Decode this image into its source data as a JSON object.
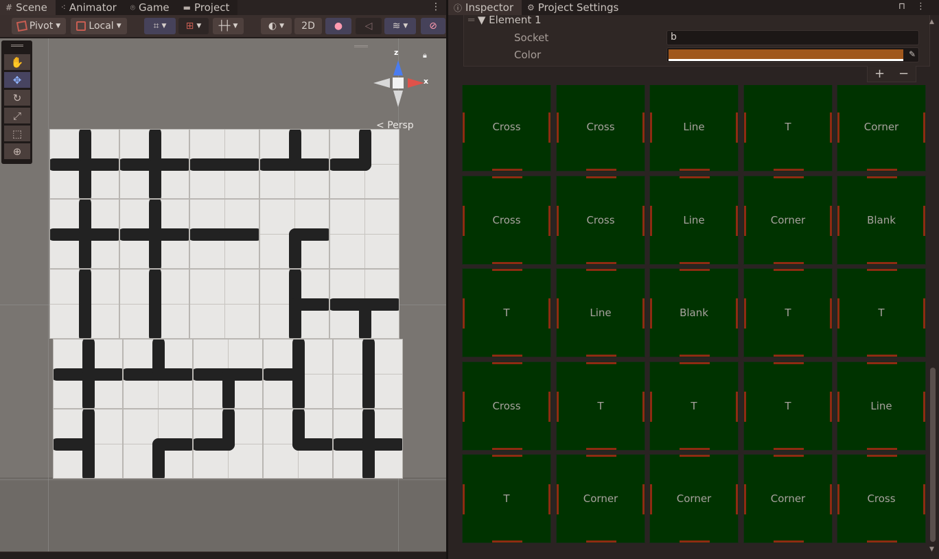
{
  "left_tabs": [
    {
      "label": "Scene",
      "icon": "grid-icon",
      "active": true
    },
    {
      "label": "Animator",
      "icon": "animator-icon",
      "active": false
    },
    {
      "label": "Game",
      "icon": "gamepad-icon",
      "active": false
    },
    {
      "label": "Project",
      "icon": "folder-icon",
      "active": false
    }
  ],
  "scene_toolbar": {
    "pivot_label": "Pivot",
    "local_label": "Local",
    "mode_2d_label": "2D"
  },
  "gizmo": {
    "z_label": "z",
    "x_label": "x",
    "projection_label": "Persp"
  },
  "right_tabs": [
    {
      "label": "Inspector",
      "icon": "info-icon",
      "active": true
    },
    {
      "label": "Project Settings",
      "icon": "gear-icon",
      "active": false
    }
  ],
  "inspector": {
    "element_header": "Element 1",
    "socket_label": "Socket",
    "socket_value": "b",
    "color_label": "Color",
    "color_value": "#A0571C",
    "add_label": "+",
    "remove_label": "−"
  },
  "tile_grid": {
    "rows": [
      [
        "Cross",
        "Cross",
        "Line",
        "T",
        "Corner"
      ],
      [
        "Cross",
        "Cross",
        "Line",
        "Corner",
        "Blank"
      ],
      [
        "T",
        "Line",
        "Blank",
        "T",
        "T"
      ],
      [
        "Cross",
        "T",
        "T",
        "T",
        "Line"
      ],
      [
        "T",
        "Corner",
        "Corner",
        "Corner",
        "Cross"
      ]
    ],
    "cell_color": "#003300",
    "socket_color": "#8F2B12"
  }
}
